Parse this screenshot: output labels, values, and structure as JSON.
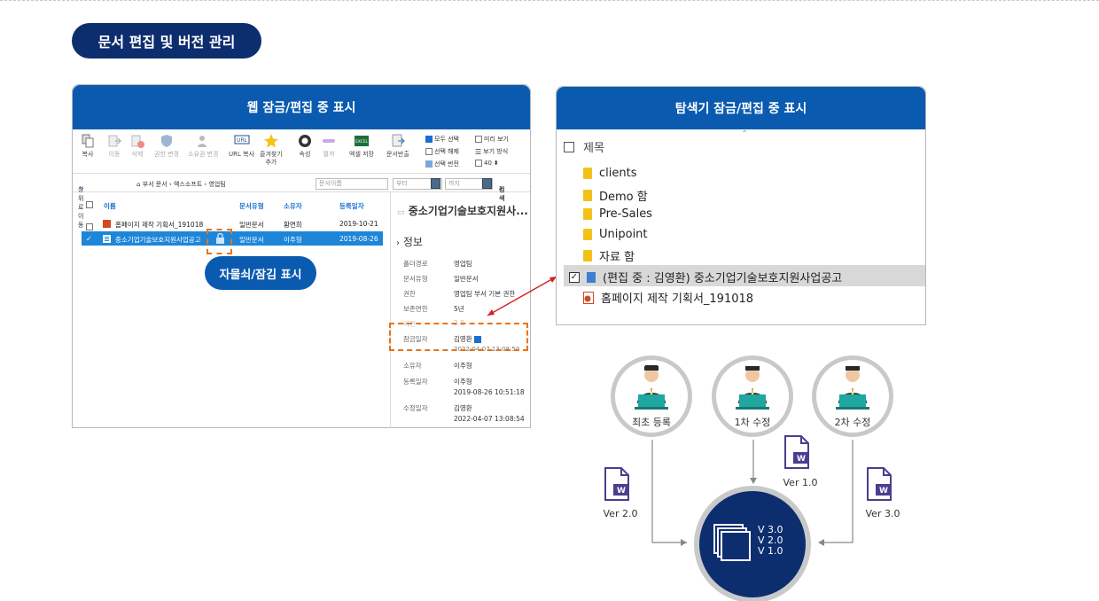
{
  "header": {
    "title": "문서 편집 및 버전 관리"
  },
  "web_panel": {
    "title": "웹 잠금/편집 중 표시",
    "toolbar": {
      "copy": "복사",
      "move": "이동",
      "delete": "삭제",
      "perm_change": "권한 변경",
      "owner_change": "소유권 변경",
      "url_copy": "URL 복사",
      "fav_add_1": "즐겨찾기",
      "fav_add_2": "추가",
      "props": "속성",
      "expand": "펼쳐",
      "excel_save": "엑셀 저장",
      "excel_icon": "EXCEL",
      "doc_return": "문서반출",
      "select_all": "모두 선택",
      "deselect": "선택 해제",
      "invert": "선택 반전",
      "preview": "미리 보기",
      "view_mode": "보기 방식",
      "page_size": "40"
    },
    "path": {
      "go_up": "상위로 이동",
      "dept_docs": "부서 문서",
      "company": "엑스소프트",
      "team": "영업팀",
      "doc_name_ph": "문서이름",
      "from_ph": "부터",
      "to_ph": "까지",
      "search": "검색"
    },
    "columns": {
      "name": "이름",
      "type": "문서유형",
      "owner": "소유자",
      "date": "등록일자"
    },
    "rows": [
      {
        "name": "홈페이지 제작 기획서_191018",
        "type": "일반문서",
        "owner": "황연희",
        "date": "2019-10-21"
      },
      {
        "name": "중소기업기술보호지원사업공고",
        "type": "일반문서",
        "owner": "이주형",
        "date": "2019-08-26"
      }
    ],
    "detail": {
      "title": "중소기업기술보호지원사...",
      "section": "정보",
      "fields": [
        {
          "label": "폴더경로",
          "value": "영업팀"
        },
        {
          "label": "문서유형",
          "value": "일반문서"
        },
        {
          "label": "권한",
          "value": "영업팀 부서 기본 권한"
        },
        {
          "label": "보존연한",
          "value": "5년"
        },
        {
          "label": "버전",
          "value": "2.0"
        },
        {
          "label": "잠금일자",
          "value": "김영환"
        },
        {
          "label": "",
          "value": "2022-04-07 13:08:50"
        },
        {
          "label": "소유자",
          "value": "이주형"
        },
        {
          "label": "등록일자",
          "value": "이주형"
        },
        {
          "label": "",
          "value": "2019-08-26 10:51:18"
        },
        {
          "label": "수정일자",
          "value": "김영환"
        },
        {
          "label": "",
          "value": "2022-04-07 13:08:54"
        }
      ]
    },
    "lock_label": "자물쇠/잠김 표시"
  },
  "explorer_panel": {
    "title": "탐색기 잠금/편집 중 표시",
    "column": "제목",
    "items": [
      {
        "name": "clients"
      },
      {
        "name": "Demo 함"
      },
      {
        "name": "Pre-Sales"
      },
      {
        "name": "Unipoint"
      },
      {
        "name": "자료 함"
      }
    ],
    "selected_item": "(편집 중 : 김영환) 중소기업기술보호지원사업공고",
    "ppt_item": "홈페이지 제작 기획서_191018"
  },
  "flow": {
    "users": [
      {
        "label": "최초 등록"
      },
      {
        "label": "1차 수정"
      },
      {
        "label": "2차 수정"
      }
    ],
    "doc_badge": "W",
    "versions": {
      "v1": "Ver 1.0",
      "v2": "Ver 2.0",
      "v3": "Ver 3.0"
    },
    "center_versions": [
      "V 3.0",
      "V 2.0",
      "V 1.0"
    ]
  },
  "colors": {
    "navy": "#0d2e6e",
    "blue": "#0a5bb0",
    "highlight": "#e8731b",
    "select": "#1d86d9"
  }
}
